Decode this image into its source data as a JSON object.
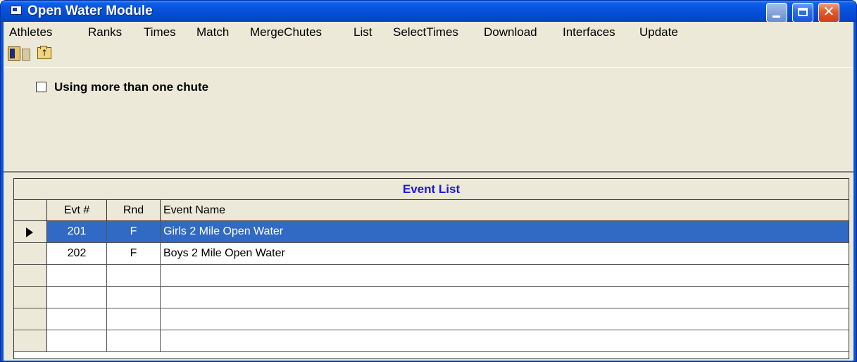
{
  "window": {
    "title": "Open Water Module"
  },
  "menu": [
    "Athletes",
    "Ranks",
    "Times",
    "Match",
    "MergeChutes",
    "List",
    "SelectTimes",
    "Download",
    "Interfaces",
    "Update"
  ],
  "options": {
    "multi_chute_label": "Using more than one chute",
    "multi_chute_checked": false
  },
  "grid": {
    "caption": "Event List",
    "columns": [
      "Evt #",
      "Rnd",
      "Event Name"
    ],
    "rows": [
      {
        "evt": "201",
        "rnd": "F",
        "name": "Girls 2 Mile Open Water",
        "selected": true
      },
      {
        "evt": "202",
        "rnd": "F",
        "name": "Boys 2 Mile Open Water",
        "selected": false
      },
      {
        "evt": "",
        "rnd": "",
        "name": "",
        "selected": false
      },
      {
        "evt": "",
        "rnd": "",
        "name": "",
        "selected": false
      },
      {
        "evt": "",
        "rnd": "",
        "name": "",
        "selected": false
      },
      {
        "evt": "",
        "rnd": "",
        "name": "",
        "selected": false
      }
    ]
  },
  "colors": {
    "selection": "#316ac5",
    "caption_text": "#1a1ad8",
    "titlebar": "#0552dc"
  }
}
